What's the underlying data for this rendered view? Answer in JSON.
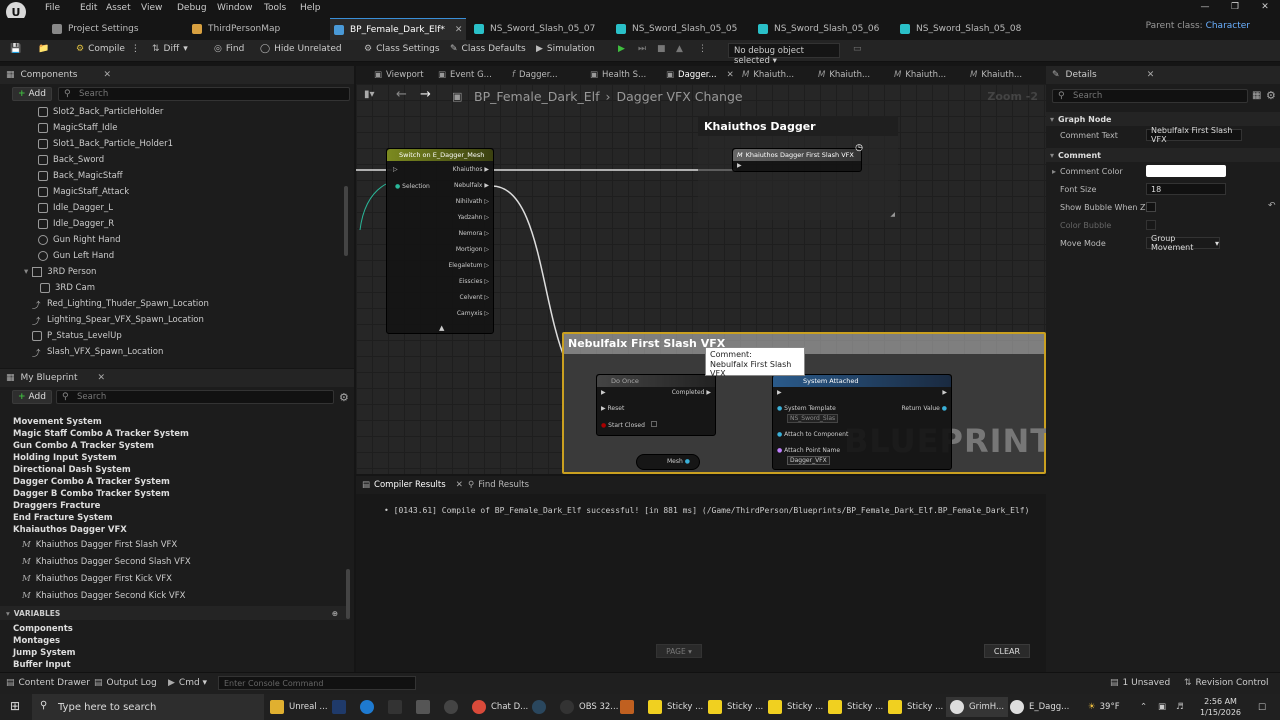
{
  "menu": {
    "items": [
      "File",
      "Edit",
      "Asset",
      "View",
      "Debug",
      "Window",
      "Tools",
      "Help"
    ]
  },
  "tabs": [
    {
      "label": "Project Settings",
      "color": "#888"
    },
    {
      "label": "ThirdPersonMap",
      "color": "#d8a040"
    },
    {
      "label": "BP_Female_Dark_Elf*",
      "color": "#4a9ad8"
    },
    {
      "label": "NS_Sword_Slash_05_07",
      "color": "#2ac0c8"
    },
    {
      "label": "NS_Sword_Slash_05_05",
      "color": "#2ac0c8"
    },
    {
      "label": "NS_Sword_Slash_05_06",
      "color": "#2ac0c8"
    },
    {
      "label": "NS_Sword_Slash_05_08",
      "color": "#2ac0c8"
    }
  ],
  "parent_class": {
    "label": "Parent class:",
    "value": "Character"
  },
  "toolbar": {
    "compile": "Compile",
    "diff": "Diff",
    "find": "Find",
    "hide_unrelated": "Hide Unrelated",
    "class_settings": "Class Settings",
    "class_defaults": "Class Defaults",
    "simulation": "Simulation",
    "debug_object": "No debug object selected"
  },
  "components": {
    "title": "Components",
    "add": "Add",
    "search_placeholder": "Search",
    "items": [
      "Slot2_Back_ParticleHolder",
      "MagicStaff_Idle",
      "Slot1_Back_Particle_Holder1",
      "Back_Sword",
      "Back_MagicStaff",
      "MagicStaff_Attack",
      "Idle_Dagger_L",
      "Idle_Dagger_R",
      "Gun Right Hand",
      "Gun Left Hand",
      "3RD Person",
      "3RD Cam",
      "Red_Lighting_Thuder_Spawn_Location",
      "Lighting_Spear_VFX_Spawn_Location",
      "P_Status_LevelUp",
      "Slash_VFX_Spawn_Location"
    ]
  },
  "my_blueprint": {
    "title": "My Blueprint",
    "add": "Add",
    "search_placeholder": "Search",
    "graphs": [
      "Movement System",
      "Magic Staff Combo A Tracker System",
      "Gun Combo A Tracker System",
      "Holding Input System",
      "Directional Dash System",
      "Dagger Combo A Tracker System",
      "Dagger B Combo Tracker System",
      "Draggers Fracture",
      "End Fracture System",
      "Khaiauthos Dagger  VFX"
    ],
    "functions": [
      "Khaiuthos Dagger First Slash VFX",
      "Khaiuthos Dagger  Second Slash VFX",
      "Khaiuthos Dagger  First Kick VFX",
      "Khaiuthos Dagger Second Kick VFX"
    ],
    "variables_label": "VARIABLES",
    "variables": [
      "Components",
      "Montages",
      "Jump System",
      "Buffer Input"
    ]
  },
  "graph_tabs": [
    "Viewport",
    "Event G...",
    "Dagger...",
    "Health S...",
    "Dagger...",
    "Khaiuth...",
    "Khaiuth...",
    "Khaiuth...",
    "Khaiuth..."
  ],
  "graph": {
    "breadcrumb_root": "BP_Female_Dark_Elf",
    "breadcrumb_leaf": "Dagger VFX Change",
    "zoom": "Zoom -2",
    "switch_node": {
      "title": "Switch on E_Dagger_Mesh",
      "selection": "Selection",
      "outs": [
        "Khaiuthos",
        "Nebulfalx",
        "Nihilvath",
        "Yadzahn",
        "Nemora",
        "Mortigon",
        "Elegaletum",
        "Eisscies",
        "Celvent",
        "Camyxis"
      ]
    },
    "comment1": {
      "title": "Khaiuthos Dagger",
      "node": "Khaiuthos Dagger First Slash VFX"
    },
    "comment2": {
      "title": "Nebulfalx First Slash VFX",
      "do_once": "Do Once",
      "completed": "Completed",
      "reset": "Reset",
      "start_closed": "Start Closed",
      "spawn": "System Attached",
      "system_template": "System Template",
      "template_val": "NS_Sword_Slas",
      "return_value": "Return Value",
      "attach": "Attach to Component",
      "attach_point": "Attach Point Name",
      "attach_val": "Dagger_VFX",
      "mesh": "Mesh"
    },
    "tooltip": {
      "line1": "Comment:",
      "line2": "Nebulfalx First Slash VFX"
    },
    "watermark": "BLUEPRINT"
  },
  "results": {
    "tab1": "Compiler Results",
    "tab2": "Find Results",
    "line": "• [0143.61] Compile of BP_Female_Dark_Elf successful! [in 881 ms] (/Game/ThirdPerson/Blueprints/BP_Female_Dark_Elf.BP_Female_Dark_Elf)",
    "page": "PAGE",
    "clear": "CLEAR"
  },
  "details": {
    "title": "Details",
    "search_placeholder": "Search",
    "section_graph": "Graph Node",
    "comment_text_label": "Comment Text",
    "comment_text": "Nebulfalx First Slash VFX",
    "section_comment": "Comment",
    "comment_color_label": "Comment Color",
    "font_size_label": "Font Size",
    "font_size": "18",
    "show_bubble_label": "Show Bubble When Z...",
    "color_bubble_label": "Color Bubble",
    "move_mode_label": "Move Mode",
    "move_mode": "Group Movement"
  },
  "statusbar": {
    "content_drawer": "Content Drawer",
    "output_log": "Output Log",
    "cmd": "Cmd",
    "console_placeholder": "Enter Console Command",
    "unsaved": "1 Unsaved",
    "revision": "Revision Control"
  },
  "taskbar": {
    "search": "Type here to search",
    "apps": [
      "Unreal ...",
      "Chat D...",
      "OBS 32...",
      "Sticky ...",
      "Sticky ...",
      "Sticky ...",
      "Sticky ...",
      "Sticky ...",
      "GrimH...",
      "E_Dagg..."
    ],
    "temp": "39°F",
    "time": "2:56 AM",
    "date": "1/15/2026"
  }
}
